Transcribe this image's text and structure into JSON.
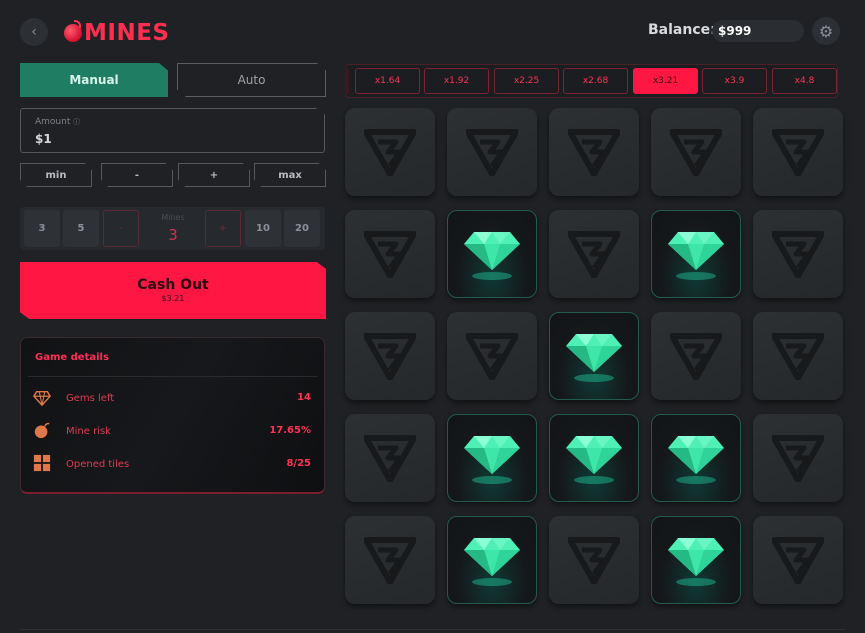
{
  "header": {
    "back_icon": "chevron-left-icon",
    "logo_text": "MINES",
    "balance_label": "Balance:",
    "balance_value": "$999",
    "settings_icon": "gear-icon"
  },
  "controls": {
    "tabs": [
      "Manual",
      "Auto"
    ],
    "active_tab": "Manual",
    "amount_label": "Amount",
    "amount_info_icon": "info-icon",
    "amount_value": "$1",
    "adjust_buttons": [
      "min",
      "-",
      "+",
      "max"
    ],
    "mine_presets_left": [
      "3",
      "5"
    ],
    "mine_presets_right": [
      "10",
      "20"
    ],
    "mines_label": "Mines",
    "mines_value": "3",
    "decrement_label": "-",
    "increment_label": "+",
    "cashout_label": "Cash Out",
    "cashout_amount": "$3.21"
  },
  "game_details": {
    "title": "Game details",
    "rows": [
      {
        "icon": "diamond-icon",
        "label": "Gems left",
        "value": "14"
      },
      {
        "icon": "bomb-icon",
        "label": "Mine risk",
        "value": "17.65%"
      },
      {
        "icon": "grid-icon",
        "label": "Opened tiles",
        "value": "8/25"
      }
    ]
  },
  "multipliers": {
    "values": [
      "x1.64",
      "x1.92",
      "x2.25",
      "x2.68",
      "x3.21",
      "x3.9",
      "x4.8"
    ],
    "active": "x3.21"
  },
  "board": {
    "rows": 5,
    "cols": 5,
    "tiles": [
      "hidden",
      "hidden",
      "hidden",
      "hidden",
      "hidden",
      "hidden",
      "gem",
      "hidden",
      "gem",
      "hidden",
      "hidden",
      "hidden",
      "gem",
      "hidden",
      "hidden",
      "hidden",
      "gem",
      "gem",
      "gem",
      "hidden",
      "hidden",
      "gem",
      "hidden",
      "gem",
      "hidden"
    ]
  },
  "colors": {
    "accent_red": "#ff1744",
    "manual_green": "#1e7d62",
    "gem_green": "#3be0a0",
    "background": "#1f2124"
  }
}
